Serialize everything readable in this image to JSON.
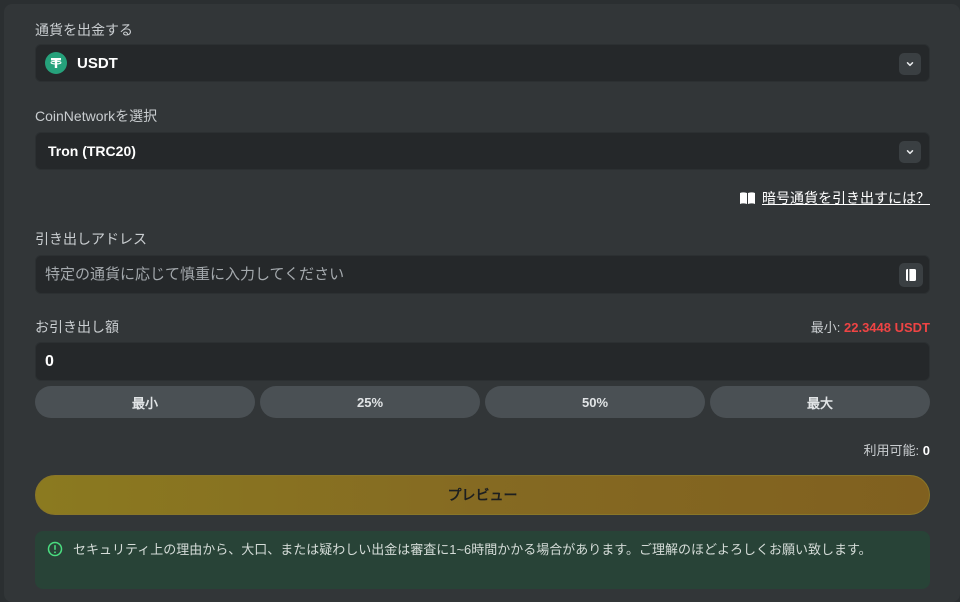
{
  "currency": {
    "label": "通貨を出金する",
    "selected": "USDT",
    "icon": "tether-icon",
    "icon_color": "#26a17b"
  },
  "network": {
    "label": "CoinNetworkを選択",
    "selected": "Tron (TRC20)"
  },
  "help_link": {
    "text": "暗号通貨を引き出すには？",
    "icon": "book-icon"
  },
  "address": {
    "label": "引き出しアドレス",
    "placeholder": "特定の通貨に応じて慎重に入力してください",
    "value": ""
  },
  "amount": {
    "label": "お引き出し額",
    "min_label": "最小: ",
    "min_value": "22.3448 USDT",
    "min_color": "#ef4444",
    "value": "0"
  },
  "quick_buttons": [
    "最小",
    "25%",
    "50%",
    "最大"
  ],
  "available": {
    "label": "利用可能: ",
    "value": "0"
  },
  "preview_button": "プレビュー",
  "notice": {
    "text": "セキュリティ上の理由から、大口、または疑わしい出金は審査に1~6時間かかる場合があります。ご理解のほどよろしくお願い致します。",
    "icon": "info-circle-icon"
  }
}
